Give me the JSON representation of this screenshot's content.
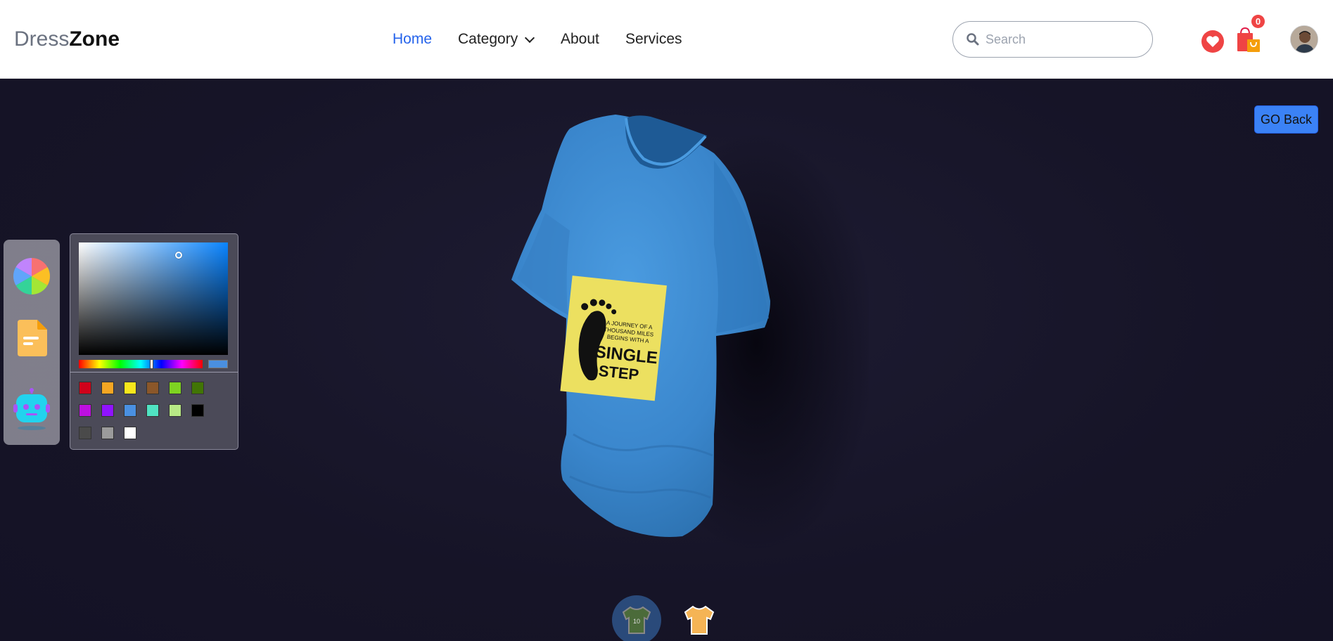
{
  "header": {
    "logo_light": "Dress",
    "logo_bold": "Zone",
    "nav": {
      "home": "Home",
      "category": "Category",
      "about": "About",
      "services": "Services"
    },
    "search": {
      "placeholder": "Search"
    },
    "cart_count": "0"
  },
  "main": {
    "go_back": "GO Back",
    "tools": [
      "color-wheel-icon",
      "file-icon",
      "robot-icon"
    ],
    "picker": {
      "hex": "#4a8fe0",
      "swatches": [
        "#d0021b",
        "#f5a623",
        "#f8e71c",
        "#8b572a",
        "#7ed321",
        "#417505",
        "#bd10e0",
        "#9013fe",
        "#4a90e2",
        "#50e3c2",
        "#b8e986",
        "#000000",
        "#4a4a4a",
        "#9b9b9b",
        "#ffffff"
      ]
    },
    "shirt": {
      "color": "#3a8bd3",
      "decal_lines": [
        "A JOURNEY OF A",
        "THOUSAND MILES",
        "BEGINS WITH A",
        "SINGLE",
        "STEP"
      ]
    },
    "thumbs": {
      "active_number": "10"
    }
  }
}
